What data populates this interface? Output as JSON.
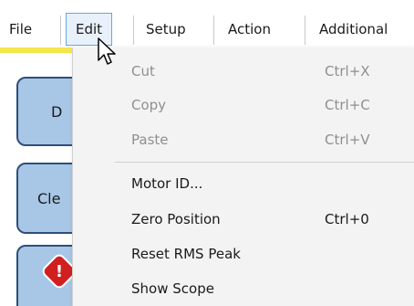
{
  "menubar": {
    "items": [
      {
        "label": "File"
      },
      {
        "label": "Edit"
      },
      {
        "label": "Setup"
      },
      {
        "label": "Action"
      },
      {
        "label": "Additional"
      }
    ],
    "accent_color": "#f2e64a"
  },
  "side_buttons": [
    {
      "label": "D"
    },
    {
      "label": "Cle"
    },
    {
      "icon": "stop-icon",
      "label": "!"
    }
  ],
  "edit_menu": {
    "items": [
      {
        "label": "Cut",
        "shortcut": "Ctrl+X",
        "enabled": false
      },
      {
        "label": "Copy",
        "shortcut": "Ctrl+C",
        "enabled": false
      },
      {
        "label": "Paste",
        "shortcut": "Ctrl+V",
        "enabled": false
      },
      {
        "label": "Motor ID...",
        "shortcut": "",
        "enabled": true
      },
      {
        "label": "Zero Position",
        "shortcut": "Ctrl+0",
        "enabled": true
      },
      {
        "label": "Reset RMS Peak",
        "shortcut": "",
        "enabled": true
      },
      {
        "label": "Show Scope",
        "shortcut": "",
        "enabled": true
      }
    ]
  }
}
